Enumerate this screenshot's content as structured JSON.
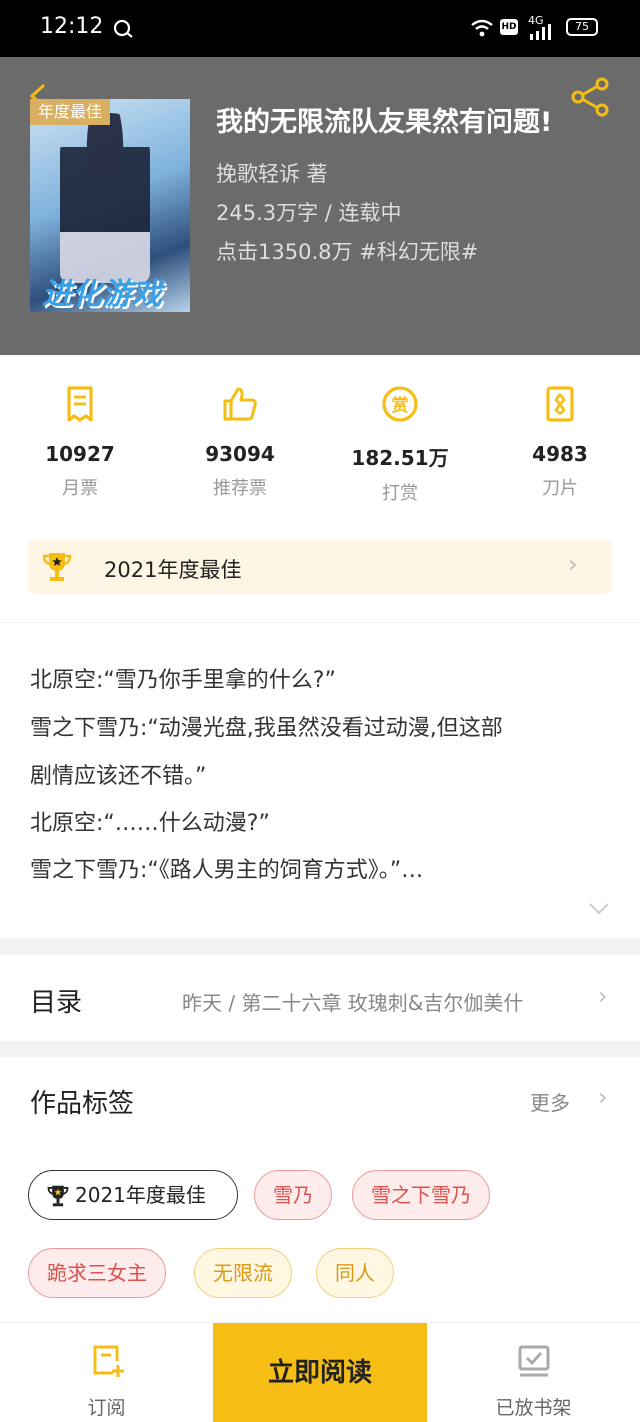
{
  "status_bar": {
    "time": "12:12",
    "network": "4G",
    "hd": "HD",
    "battery": "75"
  },
  "book": {
    "cover_badge": "年度最佳",
    "cover_art_text": "进化游戏",
    "title": "我的无限流队友果然有问题!",
    "author": "挽歌轻诉  著",
    "words_status": "245.3万字 / 连载中",
    "clicks_genre": "点击1350.8万  #科幻无限#"
  },
  "stats": [
    {
      "icon": "ticket-icon",
      "value": "10927",
      "label": "月票"
    },
    {
      "icon": "thumbs-up-icon",
      "value": "93094",
      "label": "推荐票"
    },
    {
      "icon": "reward-icon",
      "value": "182.51万",
      "label": "打赏"
    },
    {
      "icon": "blade-card-icon",
      "value": "4983",
      "label": "刀片"
    }
  ],
  "award": {
    "icon": "trophy-icon",
    "text": "2021年度最佳"
  },
  "synopsis": [
    "北原空:“雪乃你手里拿的什么?”",
    "雪之下雪乃:“动漫光盘,我虽然没看过动漫,但这部",
    "剧情应该还不错。”",
    "北原空:“……什么动漫?”",
    "雪之下雪乃:“《路人男主的饲育方式》。”…"
  ],
  "toc": {
    "title": "目录",
    "latest": "昨天 / 第二十六章 玫瑰刺&吉尔伽美什"
  },
  "tags_section": {
    "title": "作品标签",
    "more": "更多",
    "tags": [
      "2021年度最佳",
      "雪乃",
      "雪之下雪乃",
      "跪求三女主",
      "无限流",
      "同人"
    ]
  },
  "bottom_bar": {
    "subscribe": "订阅",
    "read": "立即阅读",
    "shelf": "已放书架"
  },
  "colors": {
    "accent": "#f6be14",
    "header_bg": "#6b6b6b",
    "tag_red": "#d9534f",
    "tag_gold": "#d89a18"
  }
}
